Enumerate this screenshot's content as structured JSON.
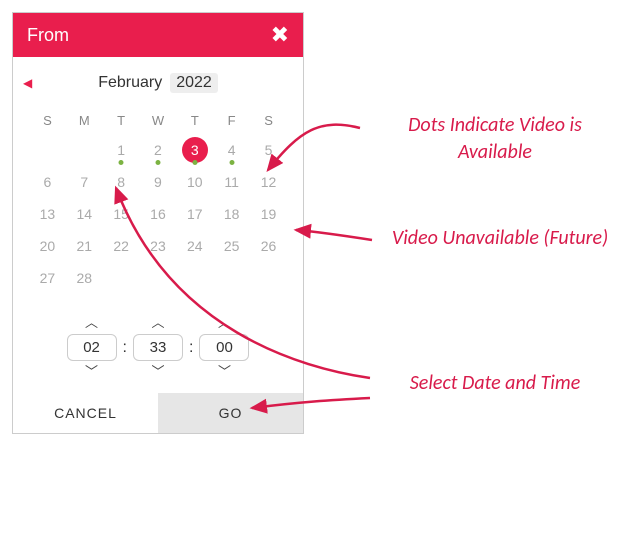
{
  "header": {
    "title": "From"
  },
  "nav": {
    "month": "February",
    "year": "2022"
  },
  "dow": [
    "S",
    "M",
    "T",
    "W",
    "T",
    "F",
    "S"
  ],
  "weeks": [
    [
      {
        "n": ""
      },
      {
        "n": ""
      },
      {
        "n": "1",
        "avail": true
      },
      {
        "n": "2",
        "avail": true
      },
      {
        "n": "3",
        "avail": true,
        "sel": true
      },
      {
        "n": "4",
        "avail": true
      },
      {
        "n": "5"
      }
    ],
    [
      {
        "n": "6"
      },
      {
        "n": "7"
      },
      {
        "n": "8"
      },
      {
        "n": "9"
      },
      {
        "n": "10"
      },
      {
        "n": "11"
      },
      {
        "n": "12"
      }
    ],
    [
      {
        "n": "13"
      },
      {
        "n": "14"
      },
      {
        "n": "15"
      },
      {
        "n": "16"
      },
      {
        "n": "17"
      },
      {
        "n": "18"
      },
      {
        "n": "19"
      }
    ],
    [
      {
        "n": "20"
      },
      {
        "n": "21"
      },
      {
        "n": "22"
      },
      {
        "n": "23"
      },
      {
        "n": "24"
      },
      {
        "n": "25"
      },
      {
        "n": "26"
      }
    ],
    [
      {
        "n": "27"
      },
      {
        "n": "28"
      },
      {
        "n": ""
      },
      {
        "n": ""
      },
      {
        "n": ""
      },
      {
        "n": ""
      },
      {
        "n": ""
      }
    ]
  ],
  "time": {
    "hh": "02",
    "mm": "33",
    "ss": "00"
  },
  "actions": {
    "cancel": "CANCEL",
    "go": "GO"
  },
  "annotations": {
    "dots": "Dots Indicate Video is Available",
    "unavail": "Video Unavailable (Future)",
    "select": "Select Date and Time"
  },
  "colors": {
    "brand": "#e91e4d",
    "dot": "#7cb342"
  }
}
